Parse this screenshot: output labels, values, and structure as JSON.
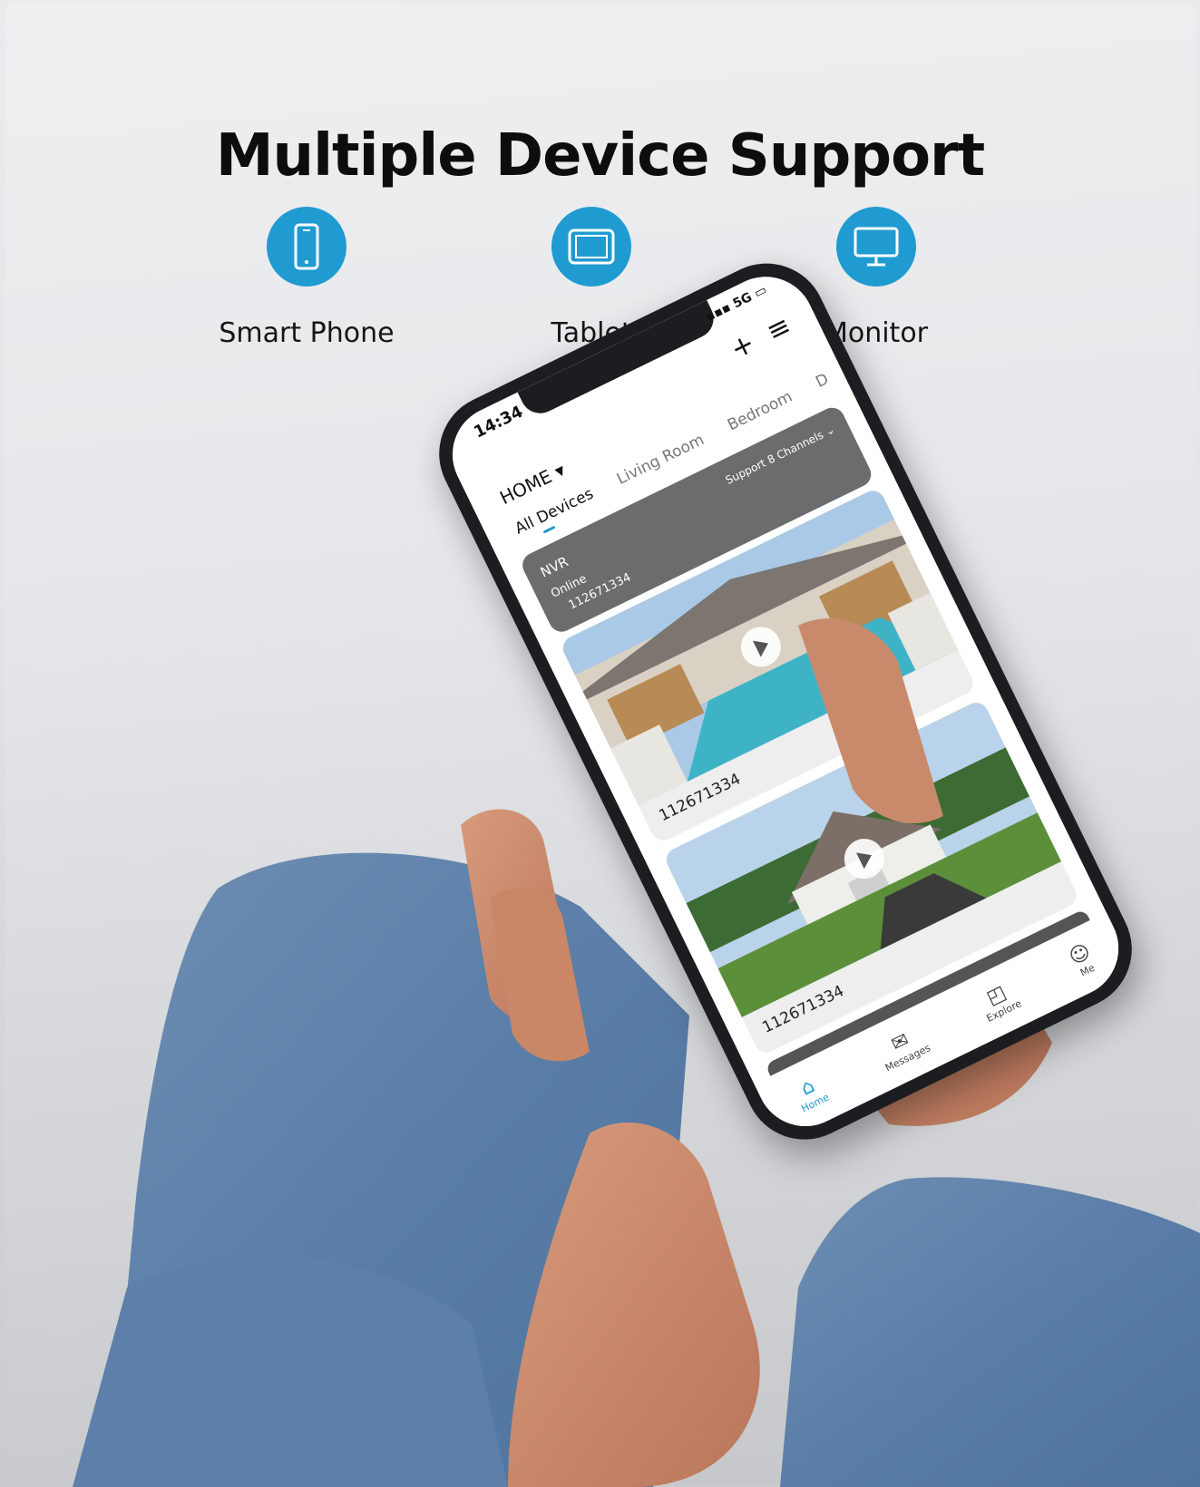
{
  "header": {
    "title": "Multiple Device Support"
  },
  "features": [
    {
      "label": "Smart Phone",
      "icon": "smartphone-icon"
    },
    {
      "label": "Tablet",
      "icon": "tablet-icon"
    },
    {
      "label": "Monitor",
      "icon": "monitor-icon"
    }
  ],
  "colors": {
    "accent": "#1f9bd1",
    "title": "#0d0d0d"
  },
  "phone_app": {
    "status_time": "14:34",
    "network": "5G",
    "home_title": "HOME ▾",
    "tabs": [
      "All Devices",
      "Living Room",
      "Bedroom",
      "D"
    ],
    "nvr": {
      "name": "NVR",
      "status": "Online",
      "id": "112671334",
      "channels": "Support 8 Channels ⌄"
    },
    "cameras": [
      {
        "id": "112671334"
      },
      {
        "id": "112671334"
      }
    ],
    "nav": [
      "Home",
      "Messages",
      "Explore",
      "Me"
    ]
  }
}
